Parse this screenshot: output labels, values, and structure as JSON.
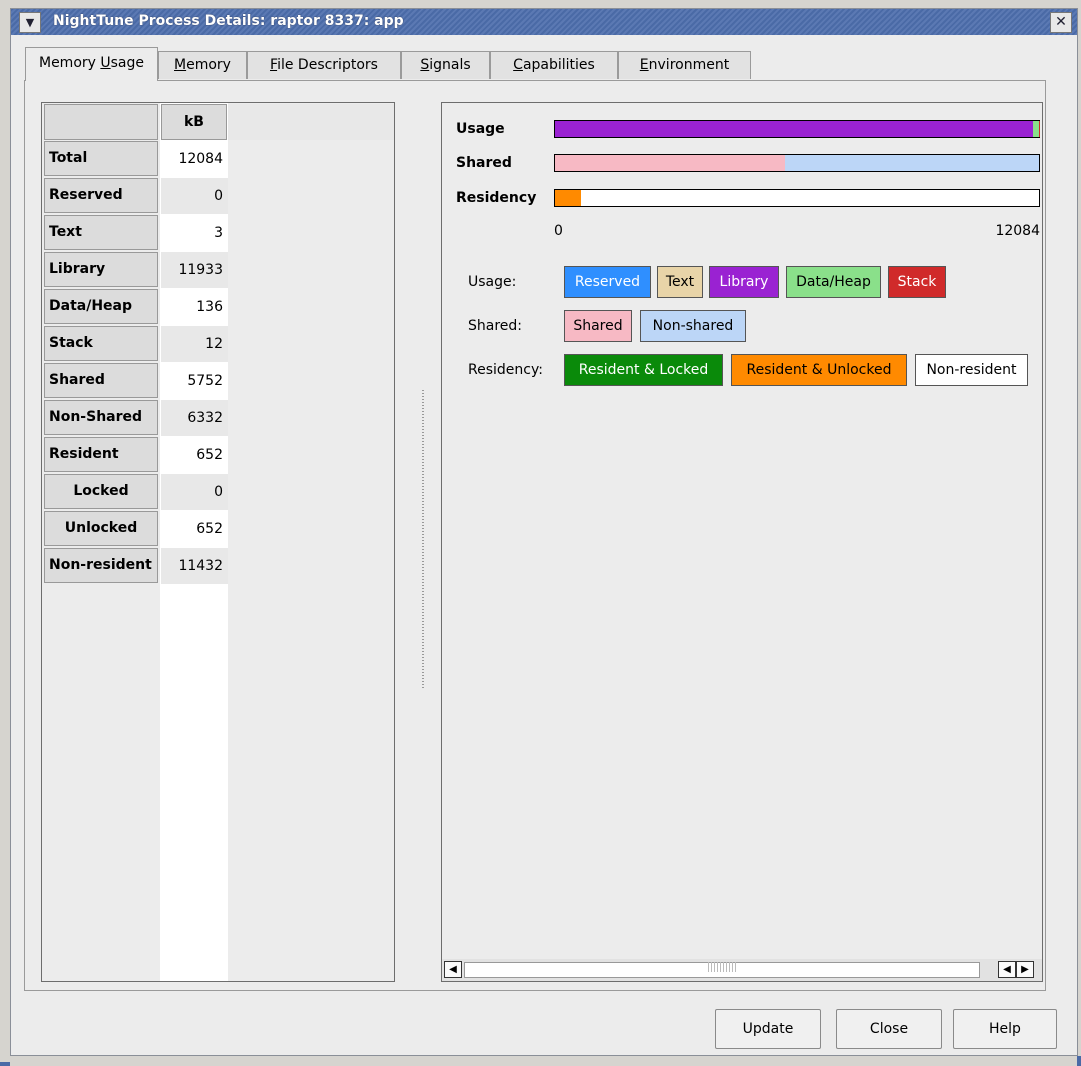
{
  "window": {
    "title": "NightTune Process Details: raptor 8337: app",
    "menu_icon": "chevron-down-icon",
    "close_icon": "close-icon"
  },
  "tabs": [
    {
      "pre": "Memory ",
      "u": "U",
      "post": "sage",
      "active": true
    },
    {
      "pre": "",
      "u": "M",
      "post": "emory",
      "active": false
    },
    {
      "pre": "",
      "u": "F",
      "post": "ile Descriptors",
      "active": false
    },
    {
      "pre": "",
      "u": "S",
      "post": "ignals",
      "active": false
    },
    {
      "pre": "",
      "u": "C",
      "post": "apabilities",
      "active": false
    },
    {
      "pre": "",
      "u": "E",
      "post": "nvironment",
      "active": false
    }
  ],
  "memory_table": {
    "column_header": "kB",
    "rows": [
      {
        "label": "Total",
        "value": "12084"
      },
      {
        "label": "Reserved",
        "value": "0"
      },
      {
        "label": "Text",
        "value": "3"
      },
      {
        "label": "Library",
        "value": "11933"
      },
      {
        "label": "Data/Heap",
        "value": "136"
      },
      {
        "label": "Stack",
        "value": "12"
      },
      {
        "label": "Shared",
        "value": "5752"
      },
      {
        "label": "Non-Shared",
        "value": "6332"
      },
      {
        "label": "Resident",
        "value": "652"
      },
      {
        "label": "Locked",
        "value": "0"
      },
      {
        "label": "Unlocked",
        "value": "652"
      },
      {
        "label": "Non-resident",
        "value": "11432"
      }
    ]
  },
  "bars": {
    "usage_label": "Usage",
    "shared_label": "Shared",
    "residency_label": "Residency",
    "axis_min": "0",
    "axis_max": "12084",
    "total": 12084,
    "usage_segments": [
      {
        "name": "Reserved",
        "value": 0,
        "color": "#2f8fff"
      },
      {
        "name": "Text",
        "value": 3,
        "color": "#e8d4a8"
      },
      {
        "name": "Library",
        "value": 11933,
        "color": "#9a22d2"
      },
      {
        "name": "Data/Heap",
        "value": 136,
        "color": "#8ae08a"
      },
      {
        "name": "Stack",
        "value": 12,
        "color": "#d02a2a"
      }
    ],
    "shared_segments": [
      {
        "name": "Shared",
        "value": 5752,
        "color": "#f7b9c4"
      },
      {
        "name": "Non-shared",
        "value": 6332,
        "color": "#bcd6f7"
      }
    ],
    "residency_segments": [
      {
        "name": "Resident & Locked",
        "value": 0,
        "color": "#0a8a0a"
      },
      {
        "name": "Resident & Unlocked",
        "value": 652,
        "color": "#ff8a00"
      },
      {
        "name": "Non-resident",
        "value": 11432,
        "color": "#ffffff"
      }
    ]
  },
  "legend": {
    "usage_label": "Usage:",
    "shared_label": "Shared:",
    "residency_label": "Residency:",
    "usage": [
      {
        "text": "Reserved",
        "bg": "#2f8fff",
        "fg": "#ffffff"
      },
      {
        "text": "Text",
        "bg": "#e8d4a8",
        "fg": "#000000"
      },
      {
        "text": "Library",
        "bg": "#9a22d2",
        "fg": "#ffffff"
      },
      {
        "text": "Data/Heap",
        "bg": "#8ae08a",
        "fg": "#000000"
      },
      {
        "text": "Stack",
        "bg": "#d02a2a",
        "fg": "#ffffff"
      }
    ],
    "shared": [
      {
        "text": "Shared",
        "bg": "#f7b9c4",
        "fg": "#000000"
      },
      {
        "text": "Non-shared",
        "bg": "#bcd6f7",
        "fg": "#000000"
      }
    ],
    "residency": [
      {
        "text": "Resident & Locked",
        "bg": "#0a8a0a",
        "fg": "#ffffff"
      },
      {
        "text": "Resident & Unlocked",
        "bg": "#ff8a00",
        "fg": "#000000"
      },
      {
        "text": "Non-resident",
        "bg": "#ffffff",
        "fg": "#000000"
      }
    ]
  },
  "buttons": {
    "update": "Update",
    "close": "Close",
    "help": "Help"
  }
}
